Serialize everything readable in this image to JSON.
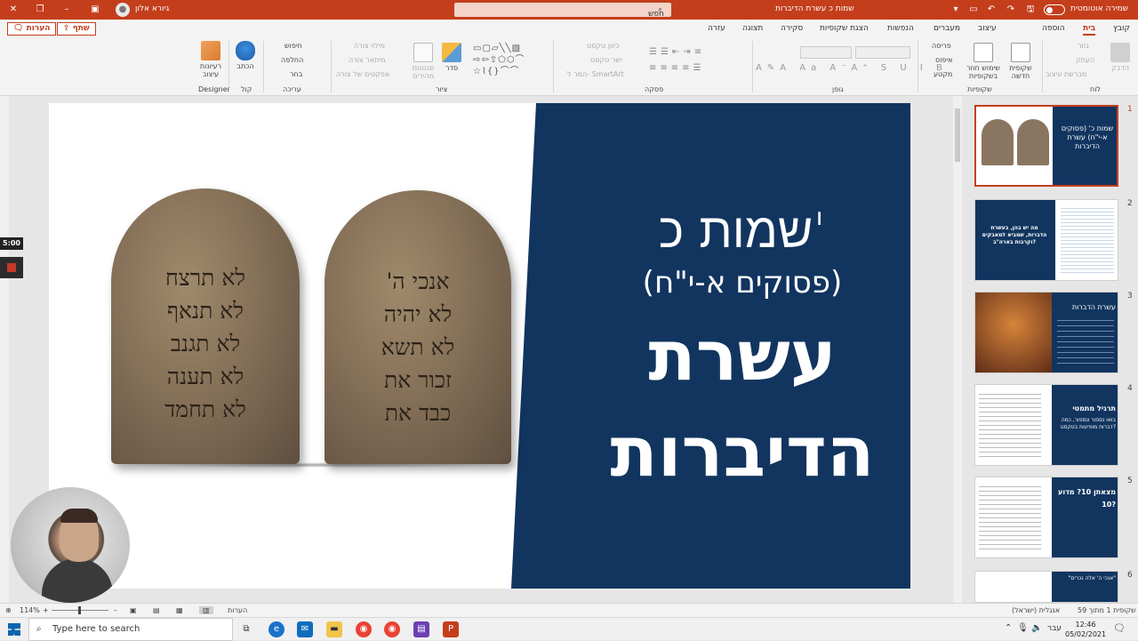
{
  "titlebar": {
    "user_name": "גיורא אלון",
    "search_placeholder": "חפש",
    "doc_title": "שמות כ עשרת הדיברות",
    "autosave_label": "שמירה אוטומטית"
  },
  "menu": {
    "items": [
      "קובץ",
      "בית",
      "הוספה",
      "עיצוב",
      "מעברים",
      "הנפשות",
      "הצגת שקופיות",
      "סקירה",
      "תצוגה",
      "עזרה"
    ],
    "active": "בית",
    "share_label": "שתף",
    "comments_label": "הערות"
  },
  "ribbon": {
    "groups": {
      "clipboard": "לוח",
      "slides": "שקופיות",
      "font": "גופן",
      "paragraph": "פסקה",
      "drawing": "ציור",
      "editing": "עריכה",
      "voice": "קול",
      "designer": "Designer"
    },
    "clipboard": {
      "paste": "הדבק",
      "format_painter": "מברשת עיצוב",
      "cut": "גזור",
      "copy": "העתק"
    },
    "slides": {
      "new_slide": "שקופית חדשה",
      "reuse": "שימוש חוזר בשקופיות",
      "layout": "פריסה",
      "reset": "איפוס",
      "section": "מקטע"
    },
    "paragraph": {
      "text_direction": "כיוון טקסט",
      "align_text": "ישר טקסט",
      "smartart": "המר ל- SmartArt"
    },
    "drawing": {
      "arrange": "סדר",
      "quick_styles": "סגנונות מהירים",
      "shape_fill": "מילוי צורה",
      "shape_outline": "מיתאר צורה",
      "shape_effects": "אפקטים של צורה"
    },
    "editing": {
      "find": "חיפוש",
      "replace": "החלפה",
      "select": "בחר"
    },
    "voice": {
      "dictate": "הכתב"
    },
    "designer": {
      "design_ideas": "רעיונות עיצוב"
    }
  },
  "slide": {
    "title_line1": "שמות כ'",
    "title_line2": "(פסוקים א-י\"ח)",
    "title_line3": "עשרת",
    "title_line4": "הדיברות",
    "tablet_right": [
      "אנכי ה'",
      "לא יהיה",
      "לא תשא",
      "זכור את",
      "כבד את"
    ],
    "tablet_left": [
      "לא תרצח",
      "לא תנאף",
      "לא תגנב",
      "לא תענה",
      "לא תחמד"
    ]
  },
  "thumbnails": [
    {
      "num": "1",
      "title": "שמות כ' (פסוקים א-י\"ח) עשרת הדיברות",
      "selected": true
    },
    {
      "num": "2",
      "title": "מה יש בהן, בעשרת הדברות, שמביא למאבקים וקרבות בארה\"ב?"
    },
    {
      "num": "3",
      "title": "עשרת הדברות"
    },
    {
      "num": "4",
      "title": "תרגיל מתמטי",
      "subtitle": "בואו נספור ונספור, כמה דברות מופיעות בטקסט?"
    },
    {
      "num": "5",
      "title": "מצאתן 10? מדוע 10?"
    },
    {
      "num": "6",
      "title": "\"אנכי ה' אלה נכרים\""
    }
  ],
  "overlay": {
    "timer": "5:00"
  },
  "statusbar": {
    "slide_info": "שקופית 1 מתוך 59",
    "language": "אנגלית (ישראל)",
    "notes": "הערות",
    "zoom": "114%"
  },
  "taskbar": {
    "search_placeholder": "Type here to search",
    "time": "12:46",
    "date": "05/02/2021",
    "lang": "עבר"
  },
  "colors": {
    "accent": "#c43e1c",
    "slide_blue": "#11355f"
  }
}
